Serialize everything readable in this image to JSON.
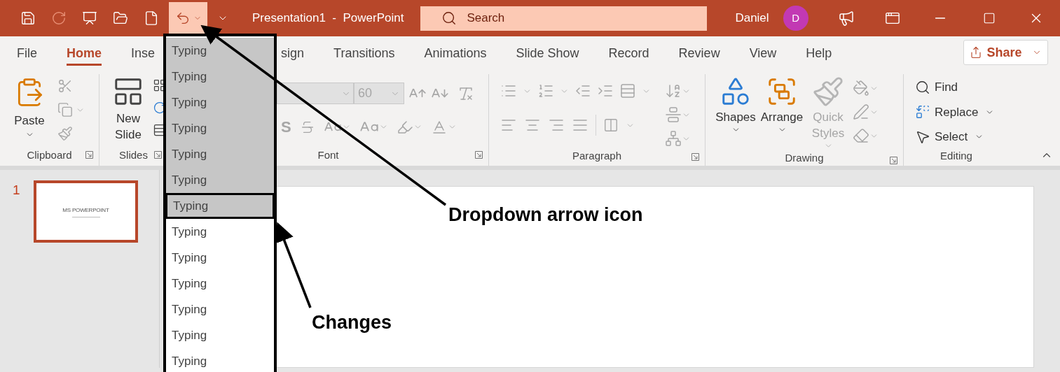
{
  "window": {
    "title": "Presentation1  -  PowerPoint",
    "user": "Daniel",
    "avatar_initial": "D"
  },
  "search": {
    "placeholder": "Search"
  },
  "tabs": [
    {
      "label": "File",
      "selected": false
    },
    {
      "label": "Home",
      "selected": true
    },
    {
      "label": "Inse",
      "selected": false
    },
    {
      "label": "sign",
      "selected": false
    },
    {
      "label": "Transitions",
      "selected": false
    },
    {
      "label": "Animations",
      "selected": false
    },
    {
      "label": "Slide Show",
      "selected": false
    },
    {
      "label": "Record",
      "selected": false
    },
    {
      "label": "Review",
      "selected": false
    },
    {
      "label": "View",
      "selected": false
    },
    {
      "label": "Help",
      "selected": false
    }
  ],
  "share_button": "Share",
  "ribbon": {
    "clipboard": {
      "label": "Clipboard",
      "paste": "Paste",
      "tools_disabled": true
    },
    "slides": {
      "label": "Slides",
      "new_slide": "New Slide"
    },
    "font": {
      "label": "Font",
      "size": "60",
      "shadow": "S",
      "disabled": true
    },
    "paragraph": {
      "label": "Paragraph",
      "disabled": true
    },
    "drawing": {
      "label": "Drawing",
      "buttons": [
        {
          "label": "Shapes",
          "disabled": false
        },
        {
          "label": "Arrange",
          "disabled": false
        },
        {
          "label": "Quick Styles",
          "disabled": true
        }
      ],
      "tools_disabled": true
    },
    "editing": {
      "label": "Editing",
      "items": [
        "Find",
        "Replace",
        "Select"
      ]
    }
  },
  "slides": [
    {
      "number": "1",
      "title": "MS POWERPOINT",
      "selected": true
    }
  ],
  "undo_menu": {
    "items": [
      {
        "label": "Typing",
        "selected": true,
        "boxed": false
      },
      {
        "label": "Typing",
        "selected": true,
        "boxed": false
      },
      {
        "label": "Typing",
        "selected": true,
        "boxed": false
      },
      {
        "label": "Typing",
        "selected": true,
        "boxed": false
      },
      {
        "label": "Typing",
        "selected": true,
        "boxed": false
      },
      {
        "label": "Typing",
        "selected": true,
        "boxed": false
      },
      {
        "label": "Typing",
        "selected": true,
        "boxed": true
      },
      {
        "label": "Typing",
        "selected": false,
        "boxed": false
      },
      {
        "label": "Typing",
        "selected": false,
        "boxed": false
      },
      {
        "label": "Typing",
        "selected": false,
        "boxed": false
      },
      {
        "label": "Typing",
        "selected": false,
        "boxed": false
      },
      {
        "label": "Typing",
        "selected": false,
        "boxed": false
      },
      {
        "label": "Typing",
        "selected": false,
        "boxed": false
      }
    ]
  },
  "annotations": [
    {
      "text": "Dropdown arrow icon"
    },
    {
      "text": "Changes"
    }
  ]
}
